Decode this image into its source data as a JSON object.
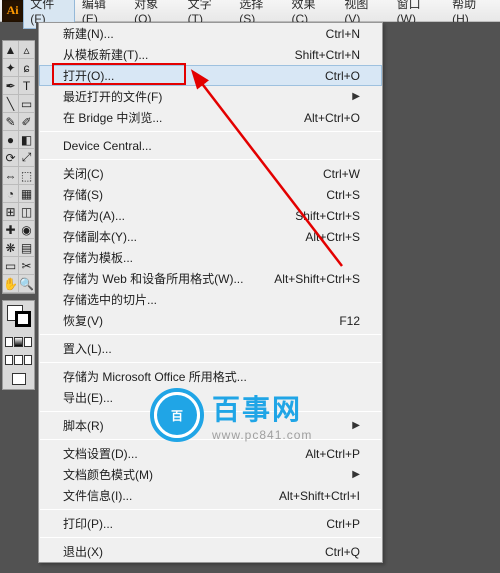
{
  "app_icon": "Ai",
  "menus": [
    "文件(F)",
    "编辑(E)",
    "对象(O)",
    "文字(T)",
    "选择(S)",
    "效果(C)",
    "视图(V)",
    "窗口(W)",
    "帮助(H)"
  ],
  "dropdown": [
    {
      "type": "item",
      "label": "新建(N)...",
      "shortcut": "Ctrl+N"
    },
    {
      "type": "item",
      "label": "从模板新建(T)...",
      "shortcut": "Shift+Ctrl+N"
    },
    {
      "type": "item",
      "label": "打开(O)...",
      "shortcut": "Ctrl+O",
      "hover": true
    },
    {
      "type": "item",
      "label": "最近打开的文件(F)",
      "shortcut": "",
      "submenu": true
    },
    {
      "type": "item",
      "label": "在 Bridge 中浏览...",
      "shortcut": "Alt+Ctrl+O"
    },
    {
      "type": "sep"
    },
    {
      "type": "item",
      "label": "Device Central...",
      "shortcut": ""
    },
    {
      "type": "sep"
    },
    {
      "type": "item",
      "label": "关闭(C)",
      "shortcut": "Ctrl+W"
    },
    {
      "type": "item",
      "label": "存储(S)",
      "shortcut": "Ctrl+S"
    },
    {
      "type": "item",
      "label": "存储为(A)...",
      "shortcut": "Shift+Ctrl+S"
    },
    {
      "type": "item",
      "label": "存储副本(Y)...",
      "shortcut": "Alt+Ctrl+S"
    },
    {
      "type": "item",
      "label": "存储为模板...",
      "shortcut": ""
    },
    {
      "type": "item",
      "label": "存储为 Web 和设备所用格式(W)...",
      "shortcut": "Alt+Shift+Ctrl+S"
    },
    {
      "type": "item",
      "label": "存储选中的切片...",
      "shortcut": ""
    },
    {
      "type": "item",
      "label": "恢复(V)",
      "shortcut": "F12"
    },
    {
      "type": "sep"
    },
    {
      "type": "item",
      "label": "置入(L)...",
      "shortcut": ""
    },
    {
      "type": "sep"
    },
    {
      "type": "item",
      "label": "存储为 Microsoft Office 所用格式...",
      "shortcut": ""
    },
    {
      "type": "item",
      "label": "导出(E)...",
      "shortcut": ""
    },
    {
      "type": "sep"
    },
    {
      "type": "item",
      "label": "脚本(R)",
      "shortcut": "",
      "submenu": true
    },
    {
      "type": "sep"
    },
    {
      "type": "item",
      "label": "文档设置(D)...",
      "shortcut": "Alt+Ctrl+P"
    },
    {
      "type": "item",
      "label": "文档颜色模式(M)",
      "shortcut": "",
      "submenu": true
    },
    {
      "type": "item",
      "label": "文件信息(I)...",
      "shortcut": "Alt+Shift+Ctrl+I"
    },
    {
      "type": "sep"
    },
    {
      "type": "item",
      "label": "打印(P)...",
      "shortcut": "Ctrl+P"
    },
    {
      "type": "sep"
    },
    {
      "type": "item",
      "label": "退出(X)",
      "shortcut": "Ctrl+Q"
    }
  ],
  "watermark": {
    "badge": "百",
    "title": "百事网",
    "url": "www.pc841.com"
  }
}
